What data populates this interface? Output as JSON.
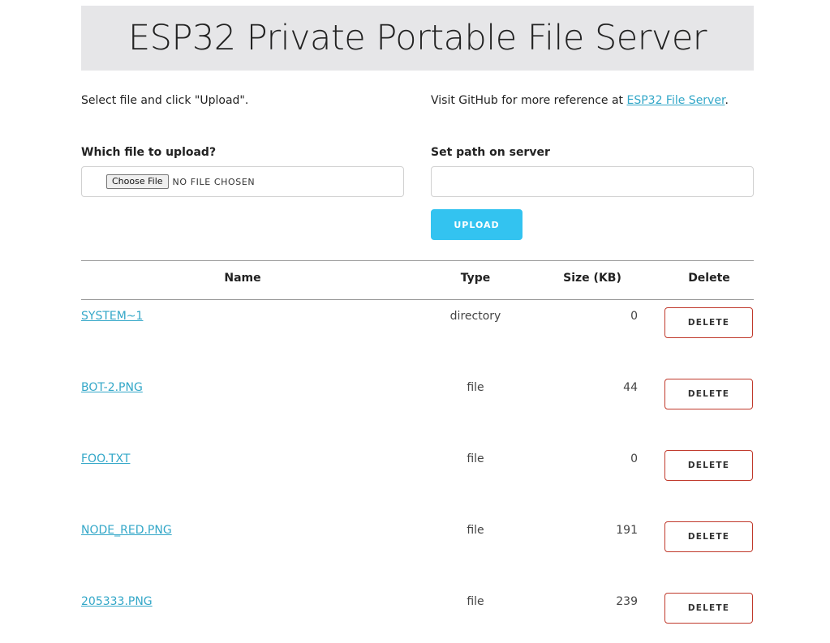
{
  "header": {
    "title": "ESP32 Private Portable File Server"
  },
  "intro": {
    "left_text": "Select file and click \"Upload\".",
    "right_prefix": "Visit GitHub for more reference at ",
    "right_link": "ESP32 File Server",
    "right_suffix": "."
  },
  "upload_form": {
    "file_label": "Which file to upload?",
    "choose_button": "Choose File",
    "no_file_text": "NO FILE CHOSEN",
    "path_label": "Set path on server",
    "path_value": "",
    "upload_button": "UPLOAD"
  },
  "table": {
    "columns": [
      "Name",
      "Type",
      "Size (KB)",
      "Delete"
    ],
    "rows": [
      {
        "name": "SYSTEM~1",
        "type": "directory",
        "size": "0",
        "delete": "DELETE"
      },
      {
        "name": "BOT-2.PNG",
        "type": "file",
        "size": "44",
        "delete": "DELETE"
      },
      {
        "name": "FOO.TXT",
        "type": "file",
        "size": "0",
        "delete": "DELETE"
      },
      {
        "name": "NODE_RED.PNG",
        "type": "file",
        "size": "191",
        "delete": "DELETE"
      },
      {
        "name": "205333.PNG",
        "type": "file",
        "size": "239",
        "delete": "DELETE"
      }
    ]
  },
  "colors": {
    "accent": "#33c3f0",
    "link": "#33a7c8",
    "delete_border": "#c0392b",
    "banner_bg": "#e6e6e8"
  }
}
